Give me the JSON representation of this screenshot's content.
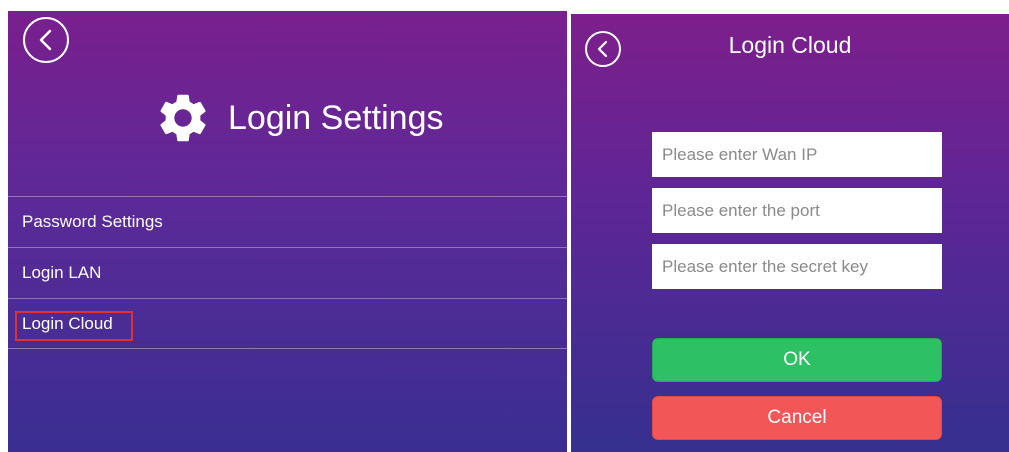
{
  "left_screen": {
    "title": "Login Settings",
    "back_icon": "back-arrow-icon",
    "header_icon": "gear-icon",
    "menu": [
      {
        "label": "Password Settings"
      },
      {
        "label": "Login LAN"
      },
      {
        "label": "Login Cloud",
        "highlighted": true
      },
      {
        "label": ""
      }
    ],
    "highlight_color": "#e03030"
  },
  "right_screen": {
    "title": "Login Cloud",
    "back_icon": "back-arrow-icon",
    "fields": {
      "wan_ip": {
        "placeholder": "Please enter Wan IP",
        "value": ""
      },
      "port": {
        "placeholder": "Please enter the port",
        "value": ""
      },
      "secret_key": {
        "placeholder": "Please enter the secret key",
        "value": ""
      }
    },
    "ok_label": "OK",
    "cancel_label": "Cancel",
    "ok_color": "#2ec064",
    "cancel_color": "#f35656"
  }
}
